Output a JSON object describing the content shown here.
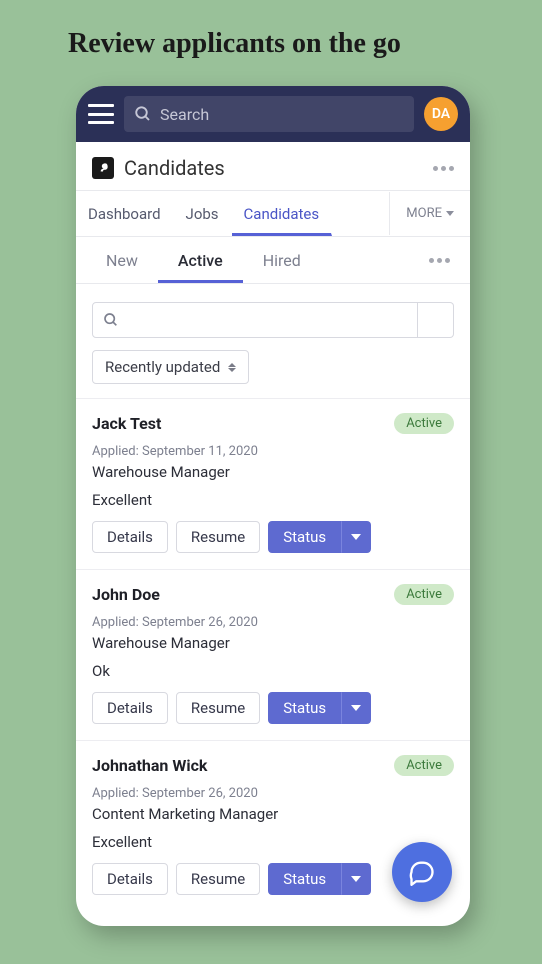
{
  "hero": {
    "title": "Review applicants on the go"
  },
  "topbar": {
    "search_placeholder": "Search",
    "avatar_initials": "DA"
  },
  "page": {
    "title": "Candidates"
  },
  "nav_primary": {
    "items": [
      {
        "label": "Dashboard"
      },
      {
        "label": "Jobs"
      },
      {
        "label": "Candidates"
      }
    ],
    "more_label": "MORE"
  },
  "nav_secondary": {
    "items": [
      {
        "label": "New"
      },
      {
        "label": "Active"
      },
      {
        "label": "Hired"
      }
    ]
  },
  "toolbar": {
    "sort_label": "Recently updated"
  },
  "buttons": {
    "details": "Details",
    "resume": "Resume",
    "status": "Status"
  },
  "candidates": [
    {
      "name": "Jack Test",
      "status": "Active",
      "applied": "Applied: September 11, 2020",
      "position": "Warehouse Manager",
      "rating": "Excellent"
    },
    {
      "name": "John Doe",
      "status": "Active",
      "applied": "Applied: September 26, 2020",
      "position": "Warehouse Manager",
      "rating": "Ok"
    },
    {
      "name": "Johnathan Wick",
      "status": "Active",
      "applied": "Applied: September 26, 2020",
      "position": "Content Marketing Manager",
      "rating": "Excellent"
    }
  ]
}
